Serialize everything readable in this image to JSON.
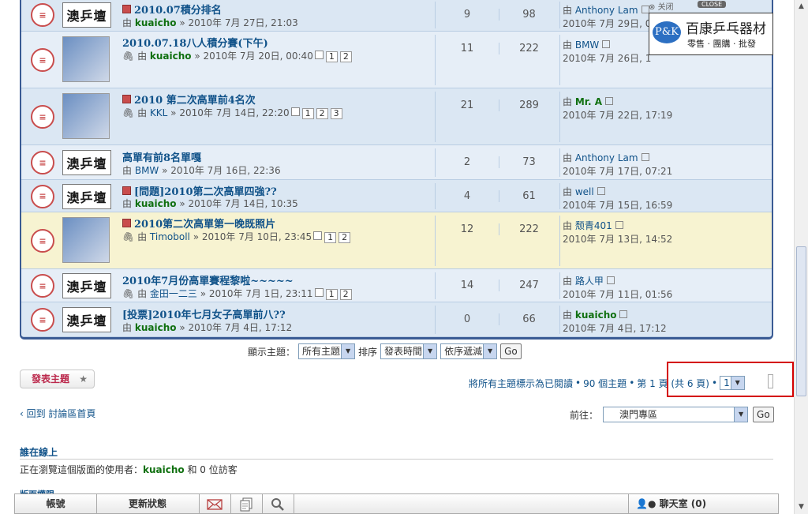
{
  "topics": [
    {
      "title": "2010.07積分排名",
      "new": true,
      "author": "kuaicho",
      "author_style": "green",
      "date": "2010年 7月 27日, 21:03",
      "attach": false,
      "pages": [],
      "replies": "9",
      "views": "98",
      "last_user": "Anthony Lam",
      "last_user_style": "plain",
      "last_date": "2010年 7月 29日, 0"
    },
    {
      "title": "2010.07.18八人積分賽(下午)",
      "new": false,
      "author": "kuaicho",
      "author_style": "green",
      "date": "2010年 7月 20日, 00:40",
      "attach": true,
      "pages": [
        "1",
        "2"
      ],
      "replies": "11",
      "views": "222",
      "last_user": "BMW",
      "last_user_style": "plain",
      "last_date": "2010年 7月 26日, 1"
    },
    {
      "title": "2010 第二次高單前4名次",
      "new": true,
      "author": "KKL",
      "author_style": "plain",
      "date": "2010年 7月 14日, 22:20",
      "attach": true,
      "pages": [
        "1",
        "2",
        "3"
      ],
      "replies": "21",
      "views": "289",
      "last_user": "Mr. A",
      "last_user_style": "green",
      "last_date": "2010年 7月 22日, 17:19"
    },
    {
      "title": "高單有前8名單嘎",
      "new": false,
      "author": "BMW",
      "author_style": "plain",
      "date": "2010年 7月 16日, 22:36",
      "attach": false,
      "pages": [],
      "replies": "2",
      "views": "73",
      "last_user": "Anthony Lam",
      "last_user_style": "plain",
      "last_date": "2010年 7月 17日, 07:21"
    },
    {
      "title": "[問題]2010第二次高單四強??",
      "new": true,
      "author": "kuaicho",
      "author_style": "green",
      "date": "2010年 7月 14日, 10:35",
      "attach": false,
      "pages": [],
      "replies": "4",
      "views": "61",
      "last_user": "well",
      "last_user_style": "plain",
      "last_date": "2010年 7月 15日, 16:59"
    },
    {
      "title": "2010第二次高單第一晚既照片",
      "new": true,
      "author": "Timoboll",
      "author_style": "plain",
      "date": "2010年 7月 10日, 23:45",
      "attach": true,
      "pages": [
        "1",
        "2"
      ],
      "replies": "12",
      "views": "222",
      "last_user": "颓青401",
      "last_user_style": "plain",
      "last_date": "2010年 7月 13日, 14:52"
    },
    {
      "title": "2010年7月份高單賽程黎啦~~~~~",
      "new": false,
      "author": "金田一二三",
      "author_style": "plain",
      "date": "2010年 7月 1日, 23:11",
      "attach": true,
      "pages": [
        "1",
        "2"
      ],
      "replies": "14",
      "views": "247",
      "last_user": "路人甲",
      "last_user_style": "plain",
      "last_date": "2010年 7月 11日, 01:56"
    },
    {
      "title": "[投票]2010年七月女子高單前八??",
      "new": false,
      "author": "kuaicho",
      "author_style": "green",
      "date": "2010年 7月 4日, 17:12",
      "attach": false,
      "pages": [],
      "replies": "0",
      "views": "66",
      "last_user": "kuaicho",
      "last_user_style": "green",
      "last_date": "2010年 7月 4日, 17:12"
    }
  ],
  "labels": {
    "by": "由",
    "sep": "»",
    "logo": "澳乒壇"
  },
  "ad": {
    "close_text": "关闭",
    "close_btn": "CLOSE",
    "logo": "P&K",
    "name": "百康乒乓器材",
    "sub": "零售 · 團購 · 批發"
  },
  "filter": {
    "show_label": "顯示主題：",
    "show_value": "所有主題",
    "sort_label": "排序",
    "sort_value": "發表時間",
    "order_value": "依序遞減",
    "go": "Go"
  },
  "post_button": "發表主題",
  "pagination": {
    "mark_read": "將所有主題標示為已閱讀",
    "count": "90 個主題",
    "page_info": "第 1 頁 (共 6 頁)",
    "bullet": "•",
    "page_value": "1"
  },
  "back_link": "‹ 回到 討論區首頁",
  "jump": {
    "label": "前往：",
    "value": "澳門專區",
    "go": "Go"
  },
  "online": {
    "heading": "誰在線上",
    "prefix": "正在瀏覽這個版面的使用者：",
    "user": "kuaicho",
    "suffix": " 和 0 位訪客"
  },
  "cut_heading": "版面權限",
  "bottombar": {
    "account": "帳號",
    "status": "更新狀態",
    "chat": "聊天室 (0)"
  }
}
